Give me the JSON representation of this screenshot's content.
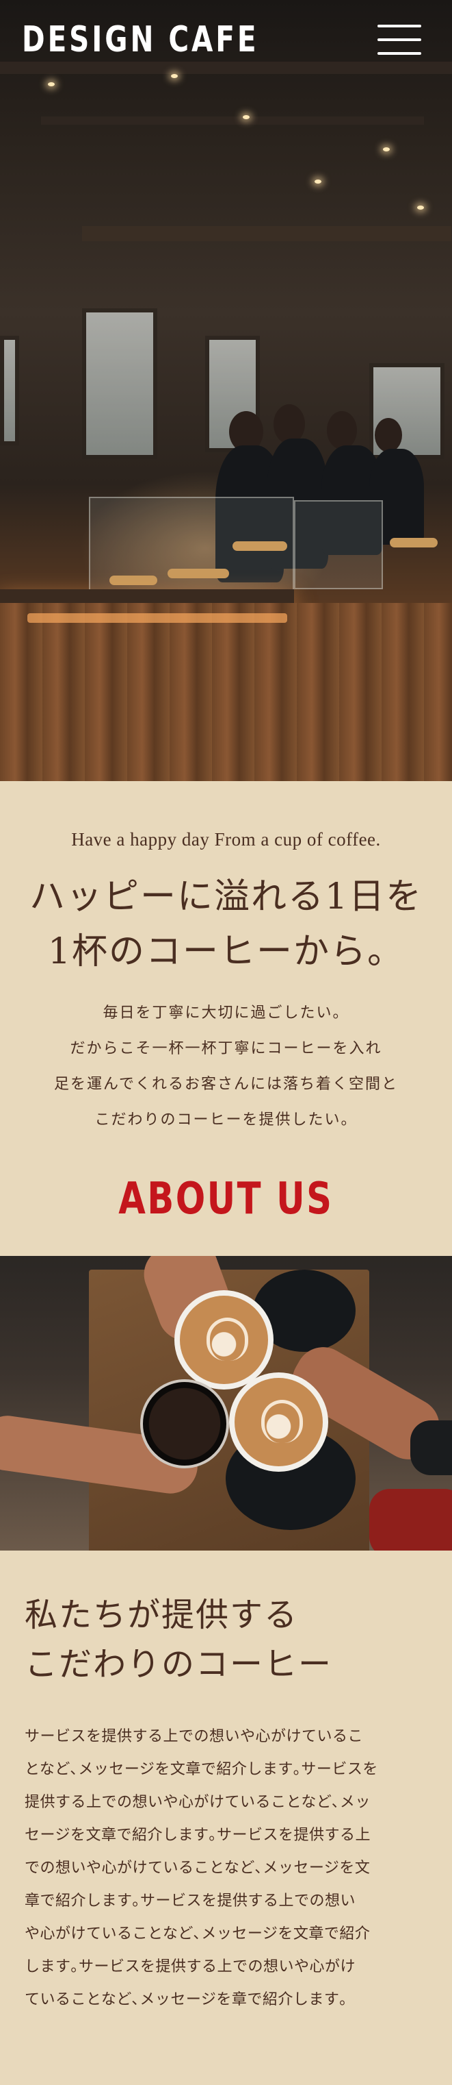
{
  "header": {
    "brand": "DESIGN CAFE",
    "menu_icon": "hamburger-menu-icon"
  },
  "intro": {
    "tagline": "Have a happy day From a cup of coffee.",
    "headline": [
      "ハッピーに溢れる1日を",
      "1杯のコーヒーから。"
    ],
    "body": [
      "毎日を丁寧に大切に過ごしたい。",
      "だからこそ一杯一杯丁寧にコーヒーを入れ",
      "足を運んでくれるお客さんには落ち着く空間と",
      "こだわりのコーヒーを提供したい。"
    ]
  },
  "about": {
    "title": "ABOUT US"
  },
  "offer": {
    "title": [
      "私たちが提供する",
      "こだわりのコーヒー"
    ],
    "body": [
      "サービスを提供する上での想いや心がけているこ",
      "となど､メッセージを文章で紹介します｡サービスを",
      "提供する上での想いや心がけていることなど､メッ",
      "セージを文章で紹介します｡サービスを提供する上",
      "での想いや心がけていることなど､メッセージを文",
      "章で紹介します｡サービスを提供する上での想い",
      "や心がけていることなど､メッセージを文章で紹介",
      "します｡サービスを提供する上での想いや心がけ",
      "ていることなど､メッセージを章で紹介します｡"
    ]
  },
  "colors": {
    "background": "#e8d9bc",
    "text": "#4a2e21",
    "accent": "#c4161c"
  }
}
